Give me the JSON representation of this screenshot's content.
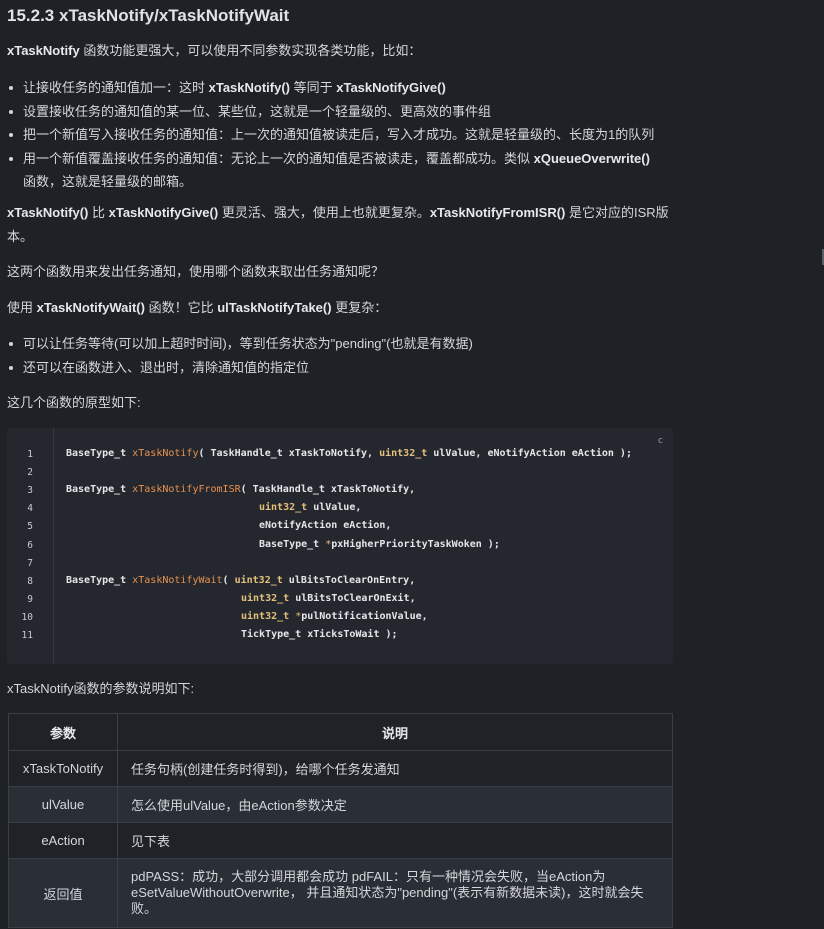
{
  "heading": "15.2.3 xTaskNotify/xTaskNotifyWait",
  "intro": {
    "b1": "xTaskNotify",
    "t1": " 函数功能更强大，可以使用不同参数实现各类功能，比如："
  },
  "list1": [
    {
      "t1": "让接收任务的通知值加一：这时 ",
      "b1": "xTaskNotify()",
      "t2": " 等同于 ",
      "b2": "xTaskNotifyGive()"
    },
    {
      "t1": "设置接收任务的通知值的某一位、某些位，这就是一个轻量级的、更高效的事件组"
    },
    {
      "t1": "把一个新值写入接收任务的通知值：上一次的通知值被读走后，写入才成功。这就是轻量级的、长度为1的队列"
    },
    {
      "t1": "用一个新值覆盖接收任务的通知值：无论上一次的通知值是否被读走，覆盖都成功。类似 ",
      "b1": "xQueueOverwrite()",
      "t2": " 函数，这就是轻量级的邮箱。"
    }
  ],
  "para2": {
    "b1": "xTaskNotify()",
    "t1": " 比 ",
    "b2": "xTaskNotifyGive()",
    "t2": " 更灵活、强大，使用上也就更复杂。",
    "b3": "xTaskNotifyFromISR()",
    "t3": " 是它对应的ISR版本。"
  },
  "para3": "这两个函数用来发出任务通知，使用哪个函数来取出任务通知呢？",
  "para4": {
    "t1": "使用 ",
    "b1": "xTaskNotifyWait()",
    "t2": " 函数！它比 ",
    "b2": "ulTaskNotifyTake()",
    "t3": " 更复杂："
  },
  "list2": [
    "可以让任务等待(可以加上超时时间)，等到任务状态为\"pending\"(也就是有数据)",
    "还可以在函数进入、退出时，清除通知值的指定位"
  ],
  "para5": "这几个函数的原型如下:",
  "code": {
    "lang": "c",
    "line_numbers": [
      "1",
      "2",
      "3",
      "4",
      "5",
      "6",
      "7",
      "8",
      "9",
      "10",
      "11"
    ],
    "l1": {
      "a": "BaseType_t ",
      "f": "xTaskNotify",
      "b": "( TaskHandle_t xTaskToNotify, ",
      "t": "uint32_t",
      "c": " ulValue, eNotifyAction eAction );"
    },
    "l3": {
      "a": "BaseType_t ",
      "f": "xTaskNotifyFromISR",
      "b": "( TaskHandle_t xTaskToNotify,"
    },
    "l4": {
      "t": "uint32_t",
      "c": " ulValue,"
    },
    "l5": "eNotifyAction eAction,",
    "l6": {
      "a": "BaseType_t ",
      "p": "*",
      "c": "pxHigherPriorityTaskWoken );"
    },
    "l8": {
      "a": "BaseType_t ",
      "f": "xTaskNotifyWait",
      "b": "( ",
      "t": "uint32_t",
      "c": " ulBitsToClearOnEntry,"
    },
    "l9": {
      "t": "uint32_t",
      "c": " ulBitsToClearOnExit,"
    },
    "l10": {
      "t": "uint32_t",
      "p": " *",
      "c": "pulNotificationValue,"
    },
    "l11": "TickType_t xTicksToWait );"
  },
  "para6": "xTaskNotify函数的参数说明如下:",
  "table": {
    "headers": [
      "参数",
      "说明"
    ],
    "rows": [
      [
        "xTaskToNotify",
        "任务句柄(创建任务时得到)，给哪个任务发通知"
      ],
      [
        "ulValue",
        "怎么使用ulValue，由eAction参数决定"
      ],
      [
        "eAction",
        "见下表"
      ],
      [
        "返回值",
        "pdPASS：成功，大部分调用都会成功 pdFAIL：只有一种情况会失败，当eAction为 eSetValueWithoutOverwrite， 并且通知状态为\"pending\"(表示有新数据未读)，这时就会失败。"
      ]
    ]
  }
}
